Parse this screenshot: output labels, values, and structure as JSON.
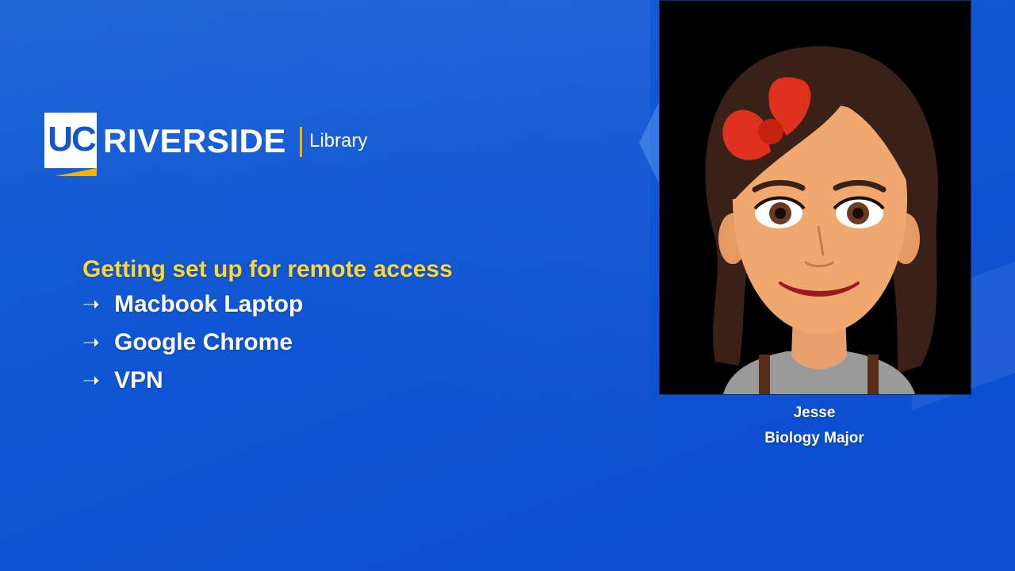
{
  "logo": {
    "badge": "UC",
    "name": "RIVERSIDE",
    "unit": "Library"
  },
  "slide": {
    "heading": "Getting set up for remote access",
    "items": [
      {
        "arrow": "➝",
        "label": "Macbook Laptop"
      },
      {
        "arrow": "➝",
        "label": "Google Chrome"
      },
      {
        "arrow": "➝",
        "label": "VPN"
      }
    ]
  },
  "presenter": {
    "name": "Jesse",
    "role": "Biology Major",
    "avatar_icon": "bitmoji-avatar-icon"
  },
  "colors": {
    "background": "#0f55d4",
    "heading": "#fdd835",
    "text": "#ffffff",
    "logo_accent": "#f2b400"
  }
}
